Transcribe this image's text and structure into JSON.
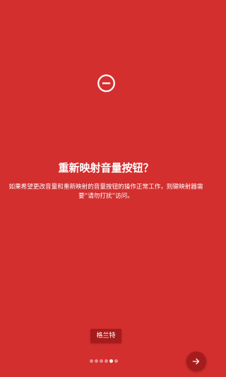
{
  "hero": {
    "icon": "remove-circle-icon"
  },
  "title": "重新映射音量按钮？",
  "description": "如果希望更改音量和重新映射的音量按钮的操作正常工作，则键映射器需要“请勿打扰”访问。",
  "grant_button": {
    "label": "格兰特"
  },
  "pager": {
    "total": 6,
    "active_index": 4
  },
  "next_button": {
    "icon": "arrow-right-icon"
  },
  "colors": {
    "background": "#d32f2f",
    "button": "#a61c1c",
    "text": "#ffffff"
  }
}
